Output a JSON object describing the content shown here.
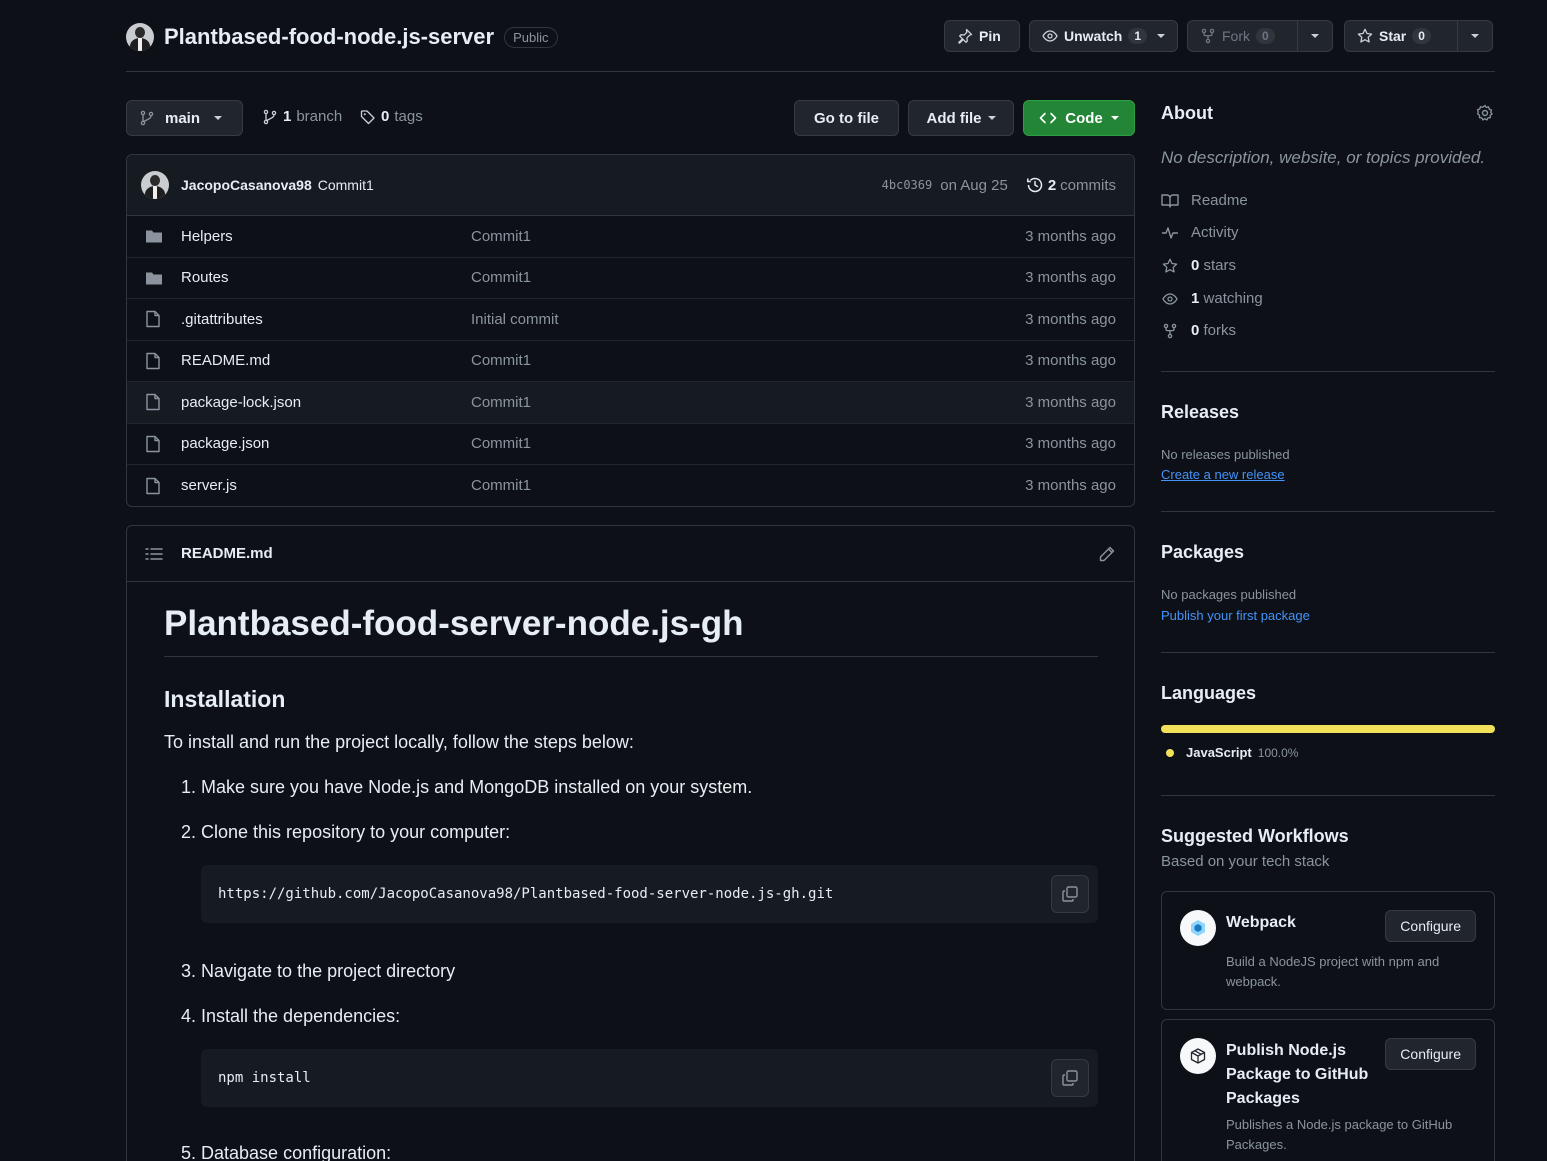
{
  "repo": {
    "name": "Plantbased-food-node.js-server",
    "visibility": "Public",
    "actions": {
      "pin": "Pin",
      "unwatch": "Unwatch",
      "watch_count": "1",
      "fork": "Fork",
      "fork_count": "0",
      "star": "Star",
      "star_count": "0"
    }
  },
  "toolbar": {
    "branch": "main",
    "branch_count": "1",
    "branch_label": "branch",
    "tag_count": "0",
    "tag_label": "tags",
    "go_to_file": "Go to file",
    "add_file": "Add file",
    "code": "Code"
  },
  "latest_commit": {
    "author": "JacopoCasanova98",
    "message": "Commit1",
    "sha": "4bc0369",
    "date": "on Aug 25",
    "commit_count": "2",
    "commit_label": "commits"
  },
  "files": [
    {
      "type": "folder",
      "name": "Helpers",
      "message": "Commit1",
      "age": "3 months ago"
    },
    {
      "type": "folder",
      "name": "Routes",
      "message": "Commit1",
      "age": "3 months ago"
    },
    {
      "type": "file",
      "name": ".gitattributes",
      "message": "Initial commit",
      "age": "3 months ago"
    },
    {
      "type": "file",
      "name": "README.md",
      "message": "Commit1",
      "age": "3 months ago"
    },
    {
      "type": "file",
      "name": "package-lock.json",
      "message": "Commit1",
      "age": "3 months ago"
    },
    {
      "type": "file",
      "name": "package.json",
      "message": "Commit1",
      "age": "3 months ago"
    },
    {
      "type": "file",
      "name": "server.js",
      "message": "Commit1",
      "age": "3 months ago"
    }
  ],
  "readme": {
    "filename": "README.md",
    "h1": "Plantbased-food-server-node.js-gh",
    "h2": "Installation",
    "intro": "To install and run the project locally, follow the steps below:",
    "step1": "1. Make sure you have Node.js and MongoDB installed on your system.",
    "step2": "2. Clone this repository to your computer:",
    "code1": "https://github.com/JacopoCasanova98/Plantbased-food-server-node.js-gh.git",
    "step3": "3. Navigate to the project directory",
    "step4": "4. Install the dependencies:",
    "code2": "npm install",
    "step5": "5. Database configuration:"
  },
  "about": {
    "title": "About",
    "description": "No description, website, or topics provided.",
    "readme": "Readme",
    "activity": "Activity",
    "stars_count": "0",
    "stars_label": "stars",
    "watching_count": "1",
    "watching_label": "watching",
    "forks_count": "0",
    "forks_label": "forks"
  },
  "releases": {
    "title": "Releases",
    "empty": "No releases published",
    "link": "Create a new release"
  },
  "packages": {
    "title": "Packages",
    "empty": "No packages published",
    "link": "Publish your first package"
  },
  "languages": {
    "title": "Languages",
    "items": [
      {
        "name": "JavaScript",
        "percent": "100.0%",
        "color": "#f1e05a",
        "fraction": 1.0
      }
    ]
  },
  "workflows": {
    "title": "Suggested Workflows",
    "subtitle": "Based on your tech stack",
    "items": [
      {
        "title": "Webpack",
        "description": "Build a NodeJS project with npm and webpack.",
        "button": "Configure"
      },
      {
        "title_line1": "Publish Node.js",
        "title_line2": "Package to GitHub",
        "title_line3": "Packages",
        "description": "Publishes a Node.js package to GitHub Packages.",
        "button": "Configure"
      }
    ]
  },
  "colors": {
    "background": "#0d1117",
    "border": "#30363d",
    "accent_green": "#238636",
    "link": "#4493f8",
    "muted": "#8b949e"
  }
}
